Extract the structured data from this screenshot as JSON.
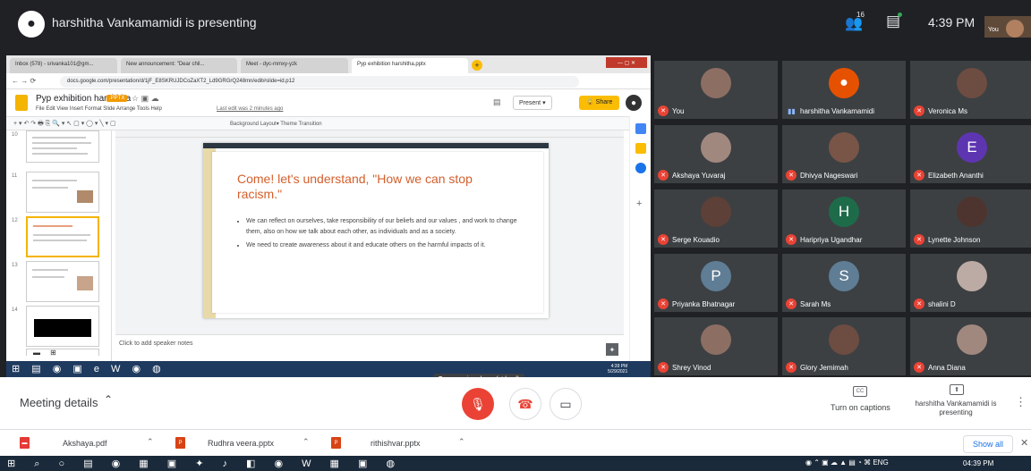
{
  "topbar": {
    "presenting_text": "harshitha Vankamamidi is presenting",
    "people_count": "16",
    "time": "4:39 PM",
    "you_label": "You"
  },
  "browser": {
    "tabs": [
      "Inbox (578) - srivanka101@gm...",
      "New announcement: \"Dear chil...",
      "Meet - dyc-mmxy-yzk",
      "Pyp exhibition harshitha.pptx"
    ],
    "url": "docs.google.com/presentation/d/1jF_E8SKRUJDCoZaXT2_Ld9GRGrQ248mn/edit#slide=id.p12"
  },
  "doc": {
    "title": "Pyp exhibition harshitha",
    "badge": ".PPTX",
    "menu": "File  Edit  View  Insert  Format  Slide  Arrange  Tools  Help",
    "last_edit": "Last edit was 2 minutes ago",
    "present_label": "Present",
    "share_label": "Share",
    "toolbar_labels": "Background    Layout▾    Theme    Transition",
    "thumb_numbers": [
      "10",
      "11",
      "12",
      "13",
      "14"
    ],
    "speaker_notes": "Click to add speaker notes"
  },
  "slide": {
    "heading": "Come! let's understand, \"How we can stop racism.\"",
    "bullets": [
      "We can reflect on ourselves, take responsibility of our beliefs and our values , and work to change them, also on how we talk about each other, as individuals and as a society.",
      "We need to create awareness about it and educate others on the harmful impacts of it."
    ]
  },
  "inner_taskbar": {
    "time": "4:39 PM",
    "date": "5/29/2021"
  },
  "mic_tooltip": "Turn on microphone (ctrl + d)",
  "participants": [
    {
      "name": "You",
      "muted": true,
      "avatar": "photo"
    },
    {
      "name": "harshitha Vankamamidi",
      "muted": false,
      "avatar": "amongus"
    },
    {
      "name": "Veronica Ms",
      "muted": true,
      "avatar": "photo"
    },
    {
      "name": "Akshaya Yuvaraj",
      "muted": true,
      "avatar": "photo"
    },
    {
      "name": "Dhivya Nageswari",
      "muted": true,
      "avatar": "photo"
    },
    {
      "name": "Elizabeth Ananthi",
      "muted": true,
      "avatar": "letter",
      "letter": "E",
      "color": "#5e35b1"
    },
    {
      "name": "Serge Kouadio",
      "muted": true,
      "avatar": "photo"
    },
    {
      "name": "Haripriya Ugandhar",
      "muted": true,
      "avatar": "letter",
      "letter": "H",
      "color": "#1e6b4a"
    },
    {
      "name": "Lynette Johnson",
      "muted": true,
      "avatar": "photo"
    },
    {
      "name": "Priyanka Bhatnagar",
      "muted": true,
      "avatar": "letter",
      "letter": "P",
      "color": "#5f7d95"
    },
    {
      "name": "Sarah Ms",
      "muted": true,
      "avatar": "letter",
      "letter": "S",
      "color": "#5f7d95"
    },
    {
      "name": "shalini D",
      "muted": true,
      "avatar": "photo"
    },
    {
      "name": "Shrey Vinod",
      "muted": true,
      "avatar": "photo"
    },
    {
      "name": "Glory Jemimah",
      "muted": true,
      "avatar": "photo"
    },
    {
      "name": "Anna Diana",
      "muted": true,
      "avatar": "photo"
    }
  ],
  "bottombar": {
    "meeting_details": "Meeting details",
    "captions_label": "Turn on captions",
    "presenting_label": "harshitha Vankamamidi is presenting"
  },
  "downloads": {
    "files": [
      "Akshaya.pdf",
      "Rudhra veera.pptx",
      "rithishvar.pptx"
    ],
    "show_all": "Show all"
  },
  "win_taskbar": {
    "lang": "ENG",
    "time": "04:39 PM"
  },
  "colors": {
    "meet_bg": "#202124",
    "mute_red": "#ea4335",
    "slide_heading": "#d35f2c",
    "share_yellow": "#fbbc04"
  }
}
